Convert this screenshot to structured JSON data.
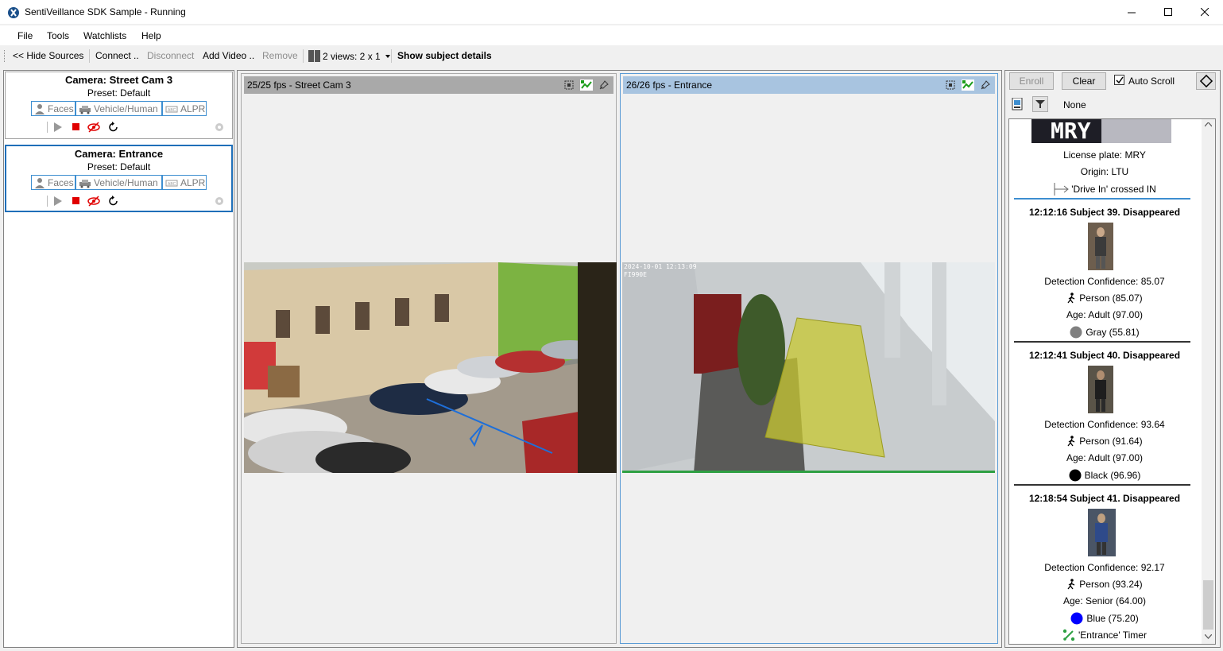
{
  "window": {
    "title": "SentiVeillance SDK Sample - Running"
  },
  "menu": {
    "file": "File",
    "tools": "Tools",
    "watchlists": "Watchlists",
    "help": "Help"
  },
  "toolbar": {
    "hide_sources": "<< Hide Sources",
    "connect": "Connect ..",
    "disconnect": "Disconnect",
    "add_video": "Add Video ..",
    "remove": "Remove",
    "views": "2 views: 2 x 1",
    "show_details": "Show subject details"
  },
  "sources": [
    {
      "title": "Camera: Street Cam 3",
      "preset": "Preset: Default",
      "modes": [
        "Faces",
        "Vehicle/Human",
        "ALPR"
      ]
    },
    {
      "title": "Camera: Entrance",
      "preset": "Preset: Default",
      "modes": [
        "Faces",
        "Vehicle/Human",
        "ALPR"
      ]
    }
  ],
  "views": [
    {
      "header": "25/25 fps  - Street Cam 3"
    },
    {
      "header": "26/26 fps  - Entrance",
      "overlay_time": "2024-10-01 12:13:09",
      "overlay_cam": "FI990E"
    }
  ],
  "right_panel": {
    "enroll": "Enroll",
    "clear": "Clear",
    "auto_scroll": "Auto Scroll",
    "filter_value": "None"
  },
  "events": {
    "plate_event": {
      "plate_text": "MRY",
      "license_plate": "License plate: MRY",
      "origin": "Origin: LTU",
      "crossing": "'Drive In' crossed IN"
    },
    "subjects": [
      {
        "header": "12:12:16  Subject 39.  Disappeared",
        "confidence": "Detection Confidence: 85.07",
        "person": "Person (85.07)",
        "age": "Age: Adult (97.00)",
        "color_label": "Gray (55.81)",
        "color": "#808080"
      },
      {
        "header": "12:12:41  Subject 40.  Disappeared",
        "confidence": "Detection Confidence: 93.64",
        "person": "Person (91.64)",
        "age": "Age: Adult (97.00)",
        "color_label": "Black (96.96)",
        "color": "#000000"
      },
      {
        "header": "12:18:54  Subject 41.  Disappeared",
        "confidence": "Detection Confidence: 92.17",
        "person": "Person (93.24)",
        "age": "Age: Senior (64.00)",
        "color_label": "Blue (75.20)",
        "color": "#0000ff",
        "timer": "'Entrance' Timer"
      }
    ]
  },
  "colors": {
    "accent": "#1f6fb9",
    "selected_header": "#a8c4e0",
    "header": "#a9a9a9",
    "stop_red": "#e00000",
    "zone_yellow": "#c8c830",
    "line_blue": "#1e6fd9"
  }
}
